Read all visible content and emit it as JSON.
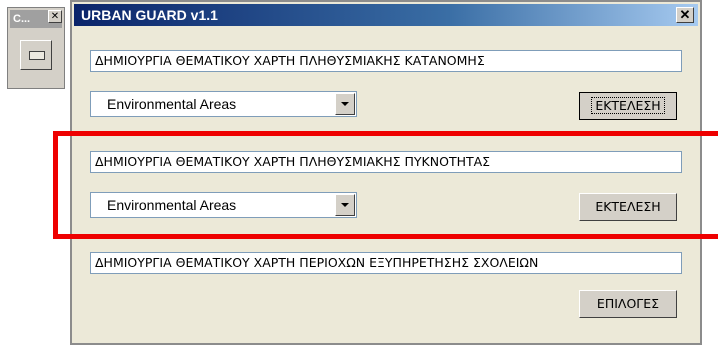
{
  "mini_window": {
    "title": "C...",
    "close_glyph": "✕"
  },
  "window": {
    "title": "URBAN GUARD v1.1",
    "close_glyph": "✕"
  },
  "sections": [
    {
      "label": "ΔΗΜΙΟΥΡΓΙΑ ΘΕΜΑΤΙΚΟΥ ΧΑΡΤΗ ΠΛΗΘΥΣΜΙΑΚΗΣ ΚΑΤΑΝΟΜΗΣ",
      "combo_value": "Environmental Areas",
      "button_label": "ΕΚΤΕΛΕΣΗ"
    },
    {
      "label": "ΔΗΜΙΟΥΡΓΙΑ ΘΕΜΑΤΙΚΟΥ ΧΑΡΤΗ ΠΛΗΘΥΣΜΙΑΚΗΣ ΠΥΚΝΟΤΗΤΑΣ",
      "combo_value": "Environmental Areas",
      "button_label": "ΕΚΤΕΛΕΣΗ"
    },
    {
      "label": "ΔΗΜΙΟΥΡΓΙΑ ΘΕΜΑΤΙΚΟΥ ΧΑΡΤΗ ΠΕΡΙΟΧΩΝ ΕΞΥΠΗΡΕΤΗΣΗΣ ΣΧΟΛΕΙΩΝ",
      "button_label": "ΕΠΙΛΟΓΕΣ"
    }
  ],
  "colors": {
    "highlight": "#ee0000",
    "titlebar": "#0a246a"
  }
}
